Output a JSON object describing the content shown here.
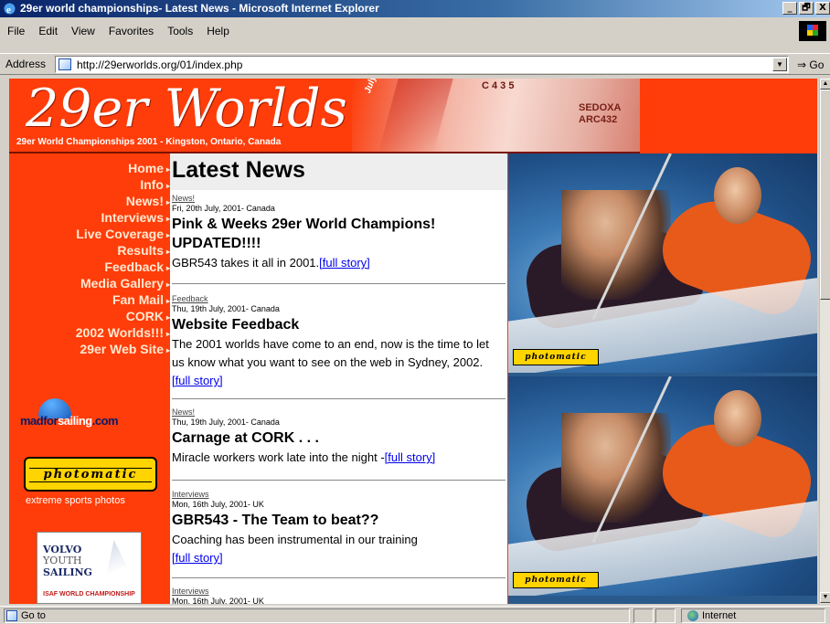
{
  "window": {
    "title": "29er world championships- Latest News - Microsoft Internet Explorer",
    "controls": [
      "_",
      "🗗",
      "X"
    ]
  },
  "menu": {
    "items": [
      "File",
      "Edit",
      "View",
      "Favorites",
      "Tools",
      "Help"
    ]
  },
  "address": {
    "label": "Address",
    "url": "http://29erworlds.org/01/index.php",
    "go": "Go"
  },
  "banner": {
    "logo": "29er Worlds",
    "subtitle": "29er World Championships 2001 - Kingston, Ontario, Canada",
    "date_badge": "July 14-20",
    "sail_number_top": "C 4 3 5",
    "sail_number_side_1": "SEDOXA",
    "sail_number_side_2": "ARC432"
  },
  "nav": {
    "items": [
      "Home",
      "Info",
      "News!",
      "Interviews",
      "Live Coverage",
      "Results",
      "Feedback",
      "Media Gallery",
      "Fan Mail",
      "CORK",
      "2002 Worlds!!!",
      "29er Web Site"
    ]
  },
  "sponsors": {
    "madforsailing": {
      "part1": "madfor",
      "part2": "sailing",
      "part3": ".com"
    },
    "photomatic": {
      "label": "photomatic",
      "caption": "extreme sports photos"
    },
    "volvo": {
      "line1": "VOLVO",
      "line2": "YOUTH",
      "line3": "SAILING",
      "line4": "ISAF WORLD CHAMPIONSHIP"
    }
  },
  "news": {
    "heading": "Latest News",
    "items": [
      {
        "category": "News!",
        "date": "Fri, 20th July, 2001- Canada",
        "headline": "Pink & Weeks 29er World Champions! UPDATED!!!!",
        "body": "GBR543 takes it all in 2001.",
        "link": "[full story]"
      },
      {
        "category": "Feedback",
        "date": "Thu, 19th July, 2001- Canada",
        "headline": "Website Feedback",
        "body": "The 2001 worlds have come to an end, now is the time to let us know what you want to see on the web in Sydney, 2002.",
        "link": "[full story]"
      },
      {
        "category": "News!",
        "date": "Thu, 19th July, 2001- Canada",
        "headline": "Carnage at CORK . . .",
        "body": "Miracle workers work late into the night -",
        "link": "[full story]"
      },
      {
        "category": "Interviews",
        "date": "Mon, 16th July, 2001- UK",
        "headline": "GBR543 - The Team to beat??",
        "body": "Coaching has been instrumental in our training",
        "link": "[full story]"
      },
      {
        "category": "Interviews",
        "date": "Mon, 16th July, 2001- UK"
      }
    ]
  },
  "photos": {
    "tag": "photomatic"
  },
  "status": {
    "text": "Go to",
    "zone": "Internet"
  }
}
